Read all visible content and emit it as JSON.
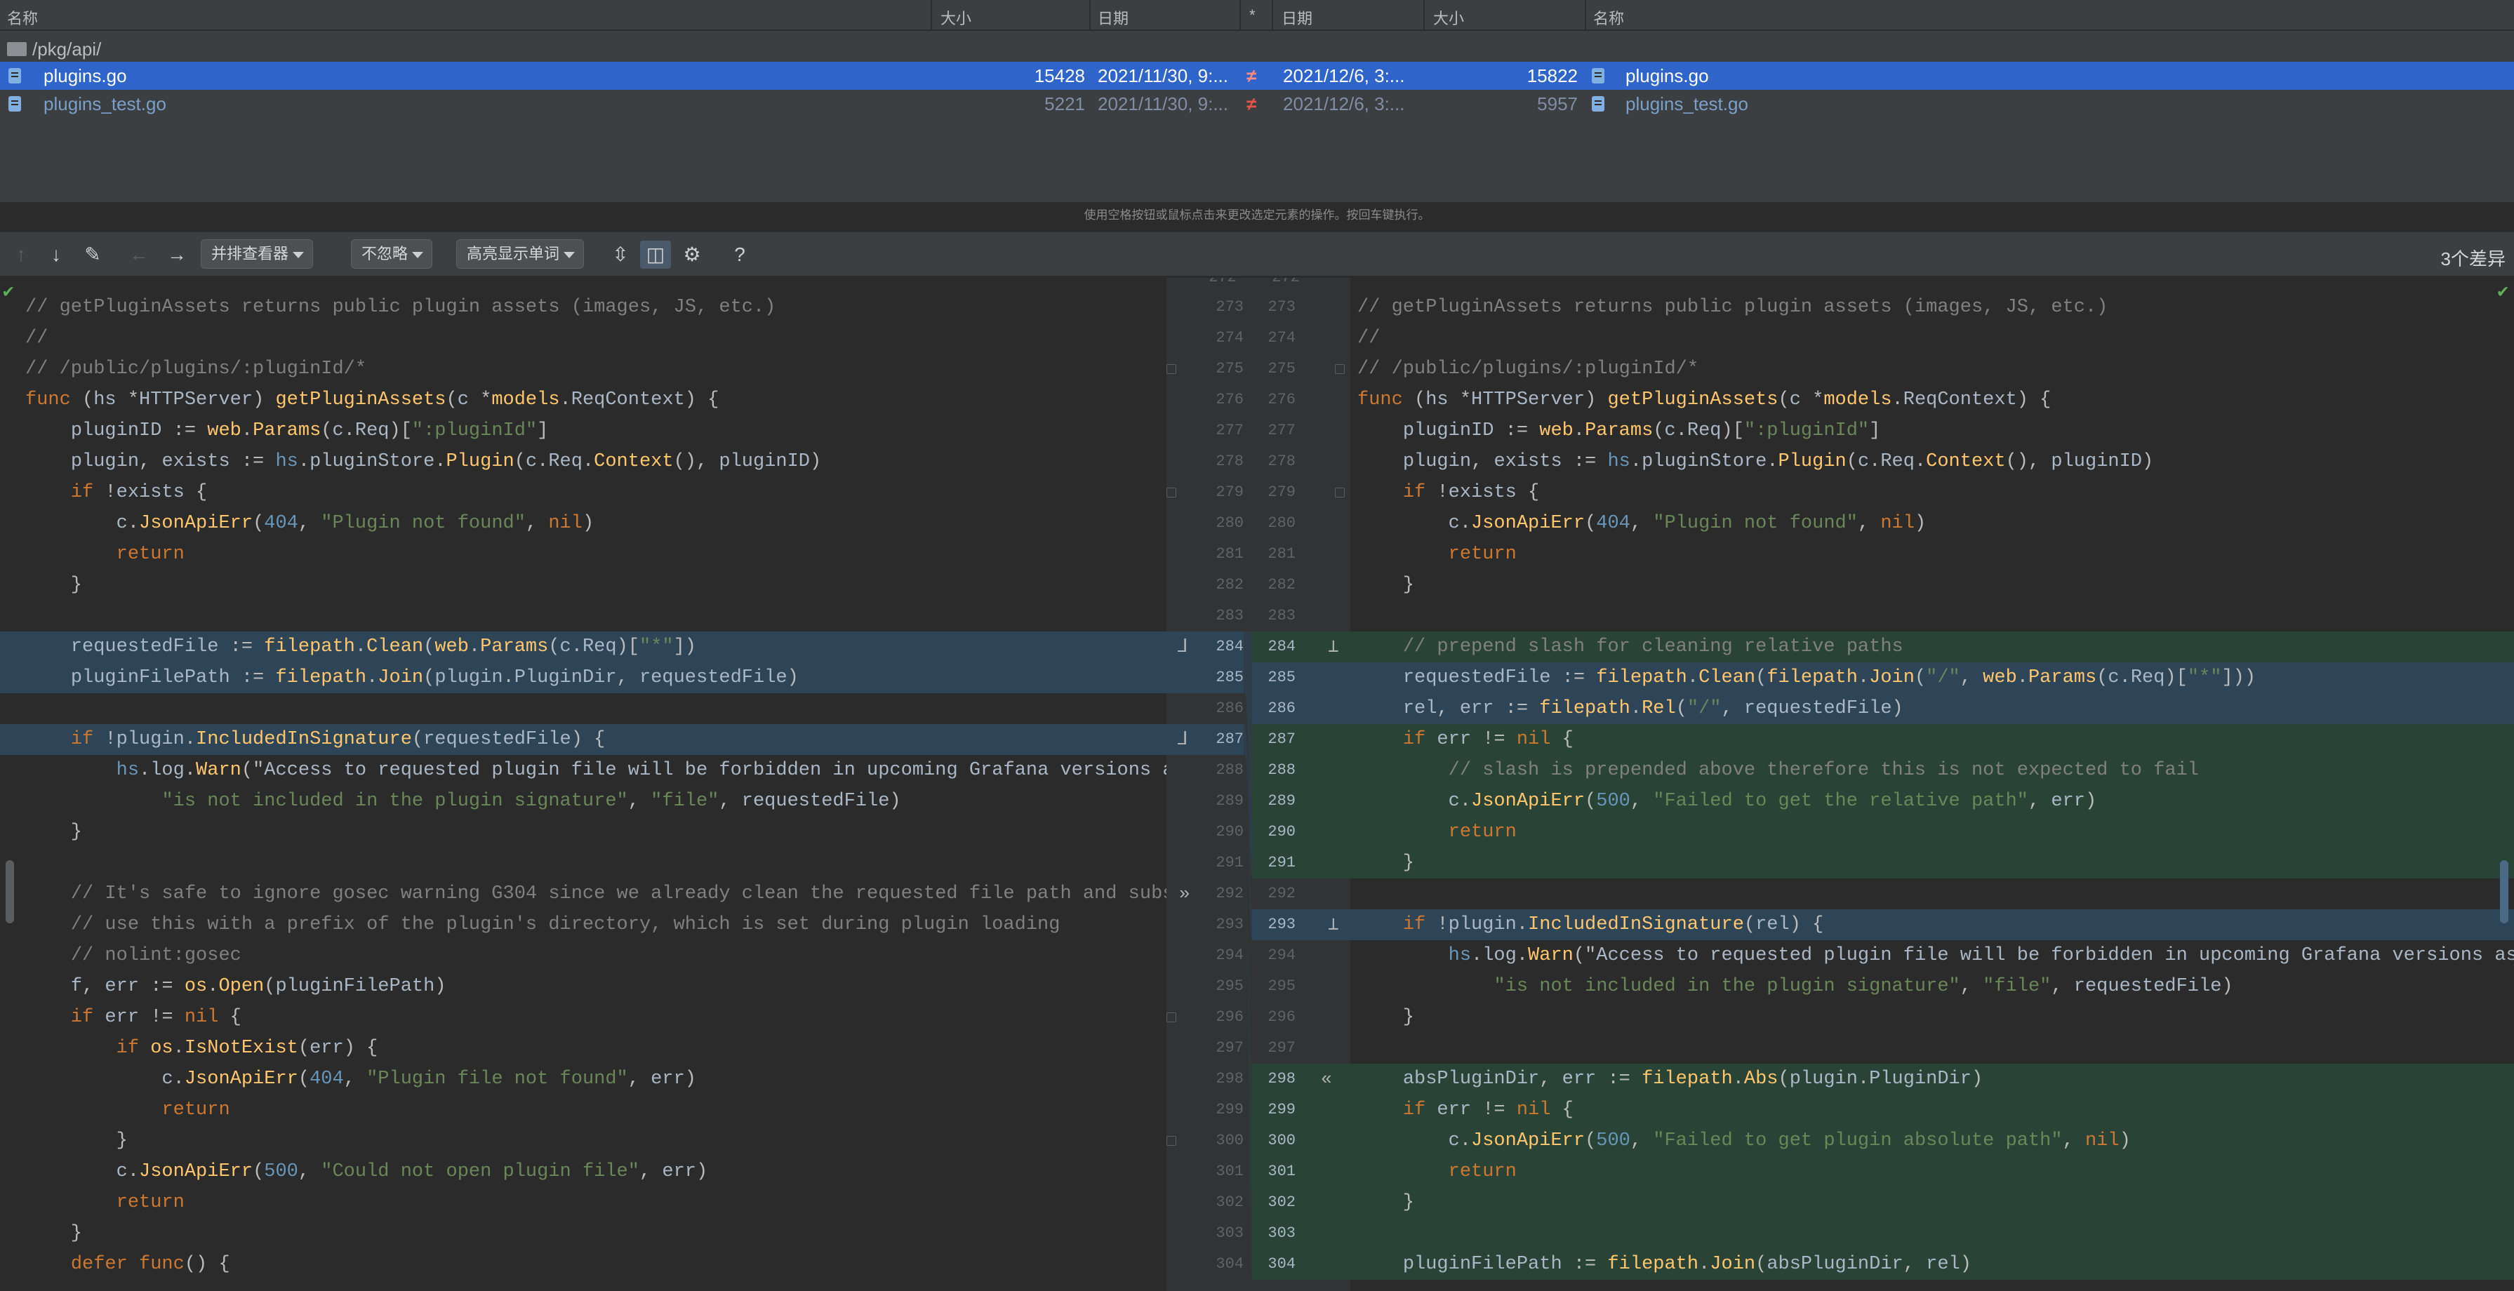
{
  "file_list": {
    "headers": {
      "left_name": "名称",
      "left_size": "大小",
      "left_date": "日期",
      "star": "*",
      "right_date": "日期",
      "right_size": "大小",
      "right_name": "名称"
    },
    "folder": "/pkg/api/",
    "rows": [
      {
        "left_name": "plugins.go",
        "left_size": "15428",
        "left_date": "2021/11/30, 9:...",
        "diff": "≠",
        "right_date": "2021/12/6, 3:...",
        "right_size": "15822",
        "right_name": "plugins.go",
        "selected": true
      },
      {
        "left_name": "plugins_test.go",
        "left_size": "5221",
        "left_date": "2021/11/30, 9:...",
        "diff": "≠",
        "right_date": "2021/12/6, 3:...",
        "right_size": "5957",
        "right_name": "plugins_test.go",
        "selected": false
      }
    ],
    "hint": "使用空格按钮或鼠标点击来更改选定元素的操作。按回车键执行。"
  },
  "toolbar": {
    "viewer_mode": "并排查看器",
    "ignore_mode": "不忽略",
    "highlight_mode": "高亮显示单词",
    "diff_count": "3个差异",
    "icons": [
      "arrow-up-icon",
      "arrow-down-icon",
      "edit-icon",
      "arrow-left-icon",
      "arrow-right-icon",
      "collapse-icon",
      "side-by-side-icon",
      "gear-icon",
      "help-icon"
    ]
  },
  "editor": {
    "left_lines": [
      {
        "ln": "273",
        "code": "// getPluginAssets returns public plugin assets (images, JS, etc.)",
        "bg": ""
      },
      {
        "ln": "274",
        "code": "//",
        "bg": ""
      },
      {
        "ln": "275",
        "code": "// /public/plugins/:pluginId/*",
        "bg": ""
      },
      {
        "ln": "276",
        "code": "func (hs *HTTPServer) getPluginAssets(c *models.ReqContext) {",
        "bg": ""
      },
      {
        "ln": "277",
        "code": "    pluginID := web.Params(c.Req)[\":pluginId\"]",
        "bg": ""
      },
      {
        "ln": "278",
        "code": "    plugin, exists := hs.pluginStore.Plugin(c.Req.Context(), pluginID)",
        "bg": ""
      },
      {
        "ln": "279",
        "code": "    if !exists {",
        "bg": ""
      },
      {
        "ln": "280",
        "code": "        c.JsonApiErr(404, \"Plugin not found\", nil)",
        "bg": ""
      },
      {
        "ln": "281",
        "code": "        return",
        "bg": ""
      },
      {
        "ln": "282",
        "code": "    }",
        "bg": ""
      },
      {
        "ln": "283",
        "code": "",
        "bg": ""
      },
      {
        "ln": "284",
        "code": "    requestedFile := filepath.Clean(web.Params(c.Req)[\"*\"])",
        "bg": "mod"
      },
      {
        "ln": "285",
        "code": "    pluginFilePath := filepath.Join(plugin.PluginDir, requestedFile)",
        "bg": "mod"
      },
      {
        "ln": "286",
        "code": "",
        "bg": ""
      },
      {
        "ln": "287",
        "code": "    if !plugin.IncludedInSignature(requestedFile) {",
        "bg": "mod"
      },
      {
        "ln": "288",
        "code": "        hs.log.Warn(\"Access to requested plugin file will be forbidden in upcoming Grafana versions a",
        "bg": ""
      },
      {
        "ln": "289",
        "code": "            \"is not included in the plugin signature\", \"file\", requestedFile)",
        "bg": ""
      },
      {
        "ln": "290",
        "code": "    }",
        "bg": ""
      },
      {
        "ln": "291",
        "code": "",
        "bg": ""
      },
      {
        "ln": "292",
        "code": "    // It's safe to ignore gosec warning G304 since we already clean the requested file path and subs",
        "bg": ""
      },
      {
        "ln": "293",
        "code": "    // use this with a prefix of the plugin's directory, which is set during plugin loading",
        "bg": ""
      },
      {
        "ln": "294",
        "code": "    // nolint:gosec",
        "bg": ""
      },
      {
        "ln": "295",
        "code": "    f, err := os.Open(pluginFilePath)",
        "bg": ""
      },
      {
        "ln": "296",
        "code": "    if err != nil {",
        "bg": ""
      },
      {
        "ln": "297",
        "code": "        if os.IsNotExist(err) {",
        "bg": ""
      },
      {
        "ln": "298",
        "code": "            c.JsonApiErr(404, \"Plugin file not found\", err)",
        "bg": ""
      },
      {
        "ln": "299",
        "code": "            return",
        "bg": ""
      },
      {
        "ln": "300",
        "code": "        }",
        "bg": ""
      },
      {
        "ln": "301",
        "code": "        c.JsonApiErr(500, \"Could not open plugin file\", err)",
        "bg": ""
      },
      {
        "ln": "302",
        "code": "        return",
        "bg": ""
      },
      {
        "ln": "303",
        "code": "    }",
        "bg": ""
      },
      {
        "ln": "304",
        "code": "    defer func() {",
        "bg": ""
      }
    ],
    "right_lines": [
      {
        "ln": "273",
        "code": "// getPluginAssets returns public plugin assets (images, JS, etc.)",
        "bg": ""
      },
      {
        "ln": "274",
        "code": "//",
        "bg": ""
      },
      {
        "ln": "275",
        "code": "// /public/plugins/:pluginId/*",
        "bg": ""
      },
      {
        "ln": "276",
        "code": "func (hs *HTTPServer) getPluginAssets(c *models.ReqContext) {",
        "bg": ""
      },
      {
        "ln": "277",
        "code": "    pluginID := web.Params(c.Req)[\":pluginId\"]",
        "bg": ""
      },
      {
        "ln": "278",
        "code": "    plugin, exists := hs.pluginStore.Plugin(c.Req.Context(), pluginID)",
        "bg": ""
      },
      {
        "ln": "279",
        "code": "    if !exists {",
        "bg": ""
      },
      {
        "ln": "280",
        "code": "        c.JsonApiErr(404, \"Plugin not found\", nil)",
        "bg": ""
      },
      {
        "ln": "281",
        "code": "        return",
        "bg": ""
      },
      {
        "ln": "282",
        "code": "    }",
        "bg": ""
      },
      {
        "ln": "283",
        "code": "",
        "bg": ""
      },
      {
        "ln": "284",
        "code": "    // prepend slash for cleaning relative paths",
        "bg": "add"
      },
      {
        "ln": "285",
        "code": "    requestedFile := filepath.Clean(filepath.Join(\"/\", web.Params(c.Req)[\"*\"]))",
        "bg": "mod"
      },
      {
        "ln": "286",
        "code": "    rel, err := filepath.Rel(\"/\", requestedFile)",
        "bg": "mod"
      },
      {
        "ln": "287",
        "code": "    if err != nil {",
        "bg": "add"
      },
      {
        "ln": "288",
        "code": "        // slash is prepended above therefore this is not expected to fail",
        "bg": "add"
      },
      {
        "ln": "289",
        "code": "        c.JsonApiErr(500, \"Failed to get the relative path\", err)",
        "bg": "add"
      },
      {
        "ln": "290",
        "code": "        return",
        "bg": "add"
      },
      {
        "ln": "291",
        "code": "    }",
        "bg": "add"
      },
      {
        "ln": "292",
        "code": "",
        "bg": ""
      },
      {
        "ln": "293",
        "code": "    if !plugin.IncludedInSignature(rel) {",
        "bg": "mod"
      },
      {
        "ln": "294",
        "code": "        hs.log.Warn(\"Access to requested plugin file will be forbidden in upcoming Grafana versions as",
        "bg": ""
      },
      {
        "ln": "295",
        "code": "            \"is not included in the plugin signature\", \"file\", requestedFile)",
        "bg": ""
      },
      {
        "ln": "296",
        "code": "    }",
        "bg": ""
      },
      {
        "ln": "297",
        "code": "",
        "bg": ""
      },
      {
        "ln": "298",
        "code": "    absPluginDir, err := filepath.Abs(plugin.PluginDir)",
        "bg": "add"
      },
      {
        "ln": "299",
        "code": "    if err != nil {",
        "bg": "add"
      },
      {
        "ln": "300",
        "code": "        c.JsonApiErr(500, \"Failed to get plugin absolute path\", nil)",
        "bg": "add"
      },
      {
        "ln": "301",
        "code": "        return",
        "bg": "add"
      },
      {
        "ln": "302",
        "code": "    }",
        "bg": "add"
      },
      {
        "ln": "303",
        "code": "",
        "bg": "add"
      },
      {
        "ln": "304",
        "code": "    pluginFilePath := filepath.Join(absPluginDir, rel)",
        "bg": "add"
      }
    ],
    "top_partial_line": "272"
  }
}
